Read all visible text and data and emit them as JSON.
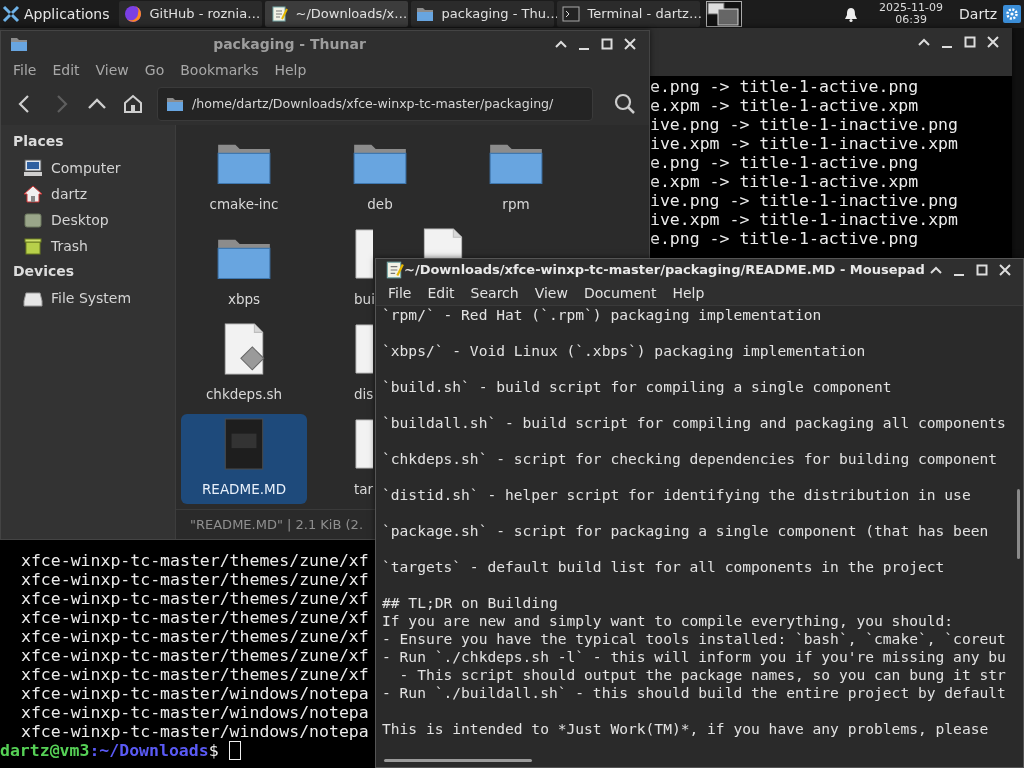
{
  "taskbar": {
    "app_menu": "Applications",
    "tasks": [
      {
        "label": "GitHub - roznia…",
        "kind": "browser",
        "selected": false
      },
      {
        "label": "~/Downloads/x…",
        "kind": "editor",
        "selected": true
      },
      {
        "label": "packaging - Thu…",
        "kind": "file-manager",
        "selected": false
      },
      {
        "label": "Terminal - dartz…",
        "kind": "terminal",
        "selected": false
      }
    ],
    "clock": {
      "date": "2025-11-09",
      "time": "06:39"
    },
    "user": "Dartz"
  },
  "terminal": {
    "lines_top": [
      "e.png -> title-1-active.png",
      "e.xpm -> title-1-active.xpm",
      "ive.png -> title-1-inactive.png",
      "ive.xpm -> title-1-inactive.xpm",
      "e.png -> title-1-active.png",
      "e.xpm -> title-1-active.xpm",
      "ive.png -> title-1-inactive.png",
      "ive.xpm -> title-1-inactive.xpm",
      "e.png -> title-1-active.png"
    ],
    "lines_bottom": [
      "xfce-winxp-tc-master/themes/zune/xf",
      "xfce-winxp-tc-master/themes/zune/xf",
      "xfce-winxp-tc-master/themes/zune/xf",
      "xfce-winxp-tc-master/themes/zune/xf",
      "xfce-winxp-tc-master/themes/zune/xf",
      "xfce-winxp-tc-master/themes/zune/xf",
      "xfce-winxp-tc-master/themes/zune/xf",
      "xfce-winxp-tc-master/windows/notepa",
      "xfce-winxp-tc-master/windows/notepa",
      "xfce-winxp-tc-master/windows/notepa"
    ],
    "prompt": {
      "user_host": "dartz@vm3",
      "path": ":~/Downloads",
      "symbol": "$"
    }
  },
  "file_manager": {
    "title": "packaging - Thunar",
    "menu": [
      "File",
      "Edit",
      "View",
      "Go",
      "Bookmarks",
      "Help"
    ],
    "toolbar": [
      {
        "kind": "back",
        "disabled": false
      },
      {
        "kind": "forward",
        "disabled": true
      },
      {
        "kind": "up",
        "disabled": false
      },
      {
        "kind": "home",
        "disabled": false
      }
    ],
    "path": "/home/dartz/Downloads/xfce-winxp-tc-master/packaging/",
    "sections": [
      {
        "heading": "Places",
        "items": [
          {
            "label": "Computer",
            "kind": "computer"
          },
          {
            "label": "dartz",
            "kind": "home"
          },
          {
            "label": "Desktop",
            "kind": "desktop"
          },
          {
            "label": "Trash",
            "kind": "trash"
          }
        ]
      },
      {
        "heading": "Devices",
        "items": [
          {
            "label": "File System",
            "kind": "drive"
          }
        ]
      }
    ],
    "icon_rows": [
      [
        {
          "label": "cmake-inc",
          "kind": "folder",
          "selected": false,
          "clipped": false
        },
        {
          "label": "deb",
          "kind": "folder",
          "selected": false,
          "clipped": false
        },
        {
          "label": "rpm",
          "kind": "folder",
          "selected": false,
          "clipped": false
        }
      ],
      [
        {
          "label": "xbps",
          "kind": "folder",
          "selected": false,
          "clipped": false
        },
        {
          "label": "bui",
          "kind": "file",
          "selected": false,
          "clipped": true
        },
        {
          "kind": "file",
          "selected": false,
          "clipped": true
        }
      ],
      [
        {
          "label": "chkdeps.sh",
          "kind": "script",
          "selected": false,
          "clipped": false
        },
        {
          "label": "dis",
          "kind": "file",
          "selected": false,
          "clipped": true
        }
      ],
      [
        {
          "label": "README.MD",
          "kind": "markdown",
          "selected": true,
          "clipped": false
        },
        {
          "label": "tar",
          "kind": "file",
          "selected": false,
          "clipped": true
        }
      ]
    ],
    "status": "\"README.MD\"  |  2.1 KiB (2."
  },
  "editor": {
    "title": "~/Downloads/xfce-winxp-tc-master/packaging/README.MD - Mousepad",
    "menu": [
      "File",
      "Edit",
      "Search",
      "View",
      "Document",
      "Help"
    ],
    "blocks": [
      [
        "`rpm/` - Red Hat (`.rpm`) packaging implementation"
      ],
      [
        "`xbps/` - Void Linux (`.xbps`) packaging implementation"
      ],
      [
        "`build.sh` - build script for compiling a single component"
      ],
      [
        "`buildall.sh` - build script for compiling and packaging all components"
      ],
      [
        "`chkdeps.sh` - script for checking dependencies for building component"
      ],
      [
        "`distid.sh` - helper script for identifying the distribution in use"
      ],
      [
        "`package.sh` - script for packaging a single component (that has been"
      ],
      [
        "`targets` - default build list for all components in the project"
      ],
      [
        "## TL;DR on Building",
        "If you are new and simply want to compile everything, you should:",
        "- Ensure you have the typical tools installed: `bash`, `cmake`, `coreut",
        "- Run `./chkdeps.sh -l` - this will inform you if you're missing any bu",
        "  - This script should output the package names, so you can bung it str",
        "- Run `./buildall.sh` - this should build the entire project by default"
      ],
      [
        "This is intended to *Just Work(TM)*, if you have any problems, please"
      ]
    ]
  }
}
